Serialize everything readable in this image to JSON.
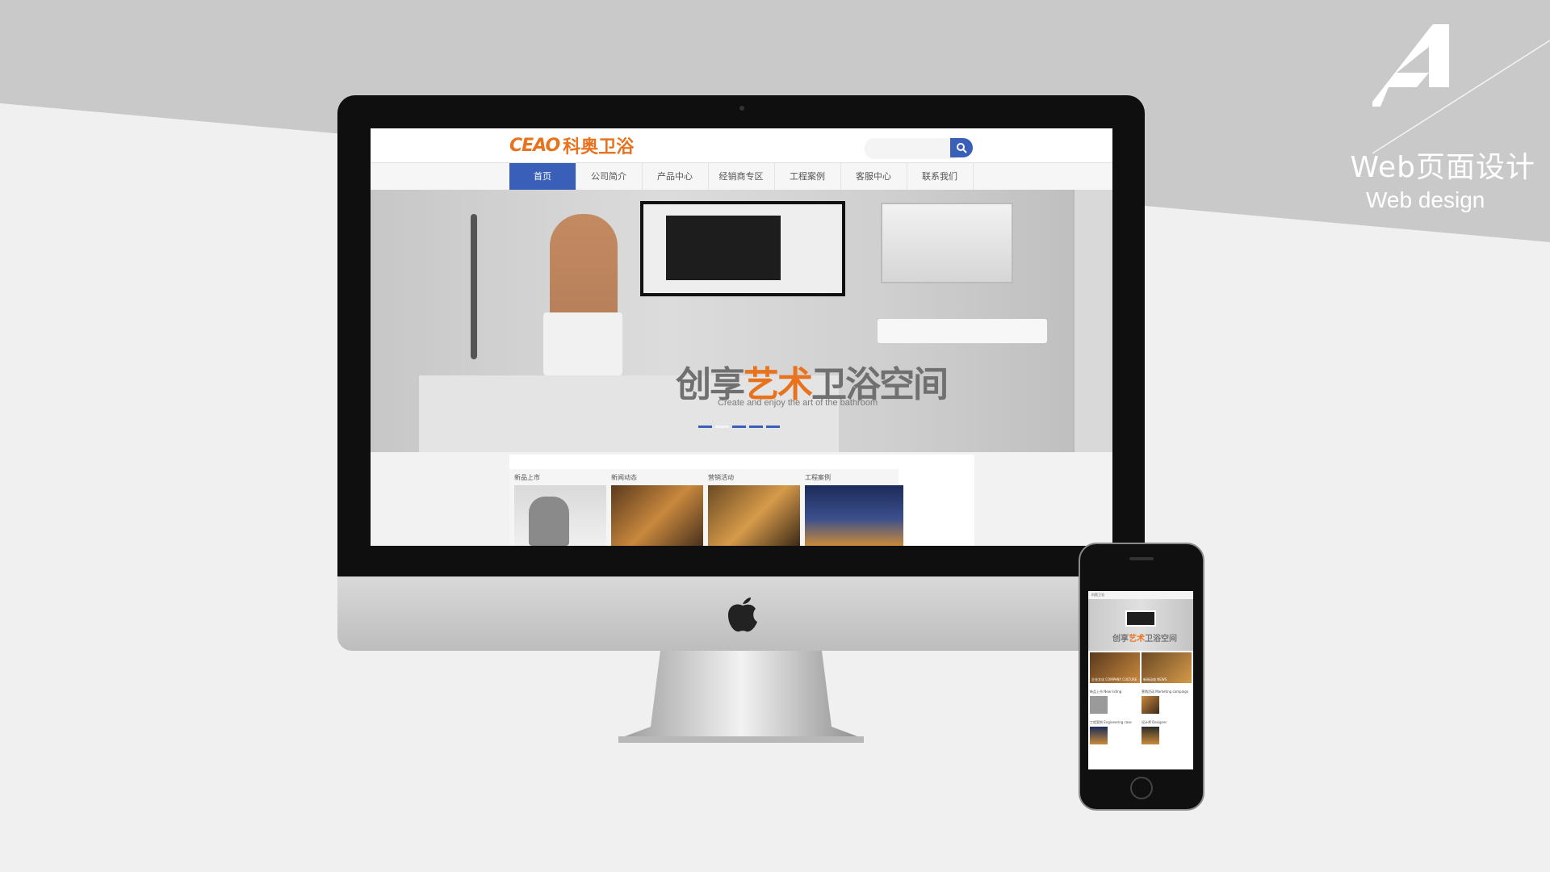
{
  "caption": {
    "title_cn": "Web页面设计",
    "title_en": "Web design"
  },
  "site": {
    "logo_en": "CEAO",
    "logo_cn": "科奥卫浴",
    "search_placeholder": "",
    "nav": [
      "首页",
      "公司简介",
      "产品中心",
      "经销商专区",
      "工程案例",
      "客服中心",
      "联系我们"
    ],
    "nav_active_index": 0,
    "hero": {
      "slogan_pre": "创享",
      "slogan_highlight": "艺术",
      "slogan_post": "卫浴空间",
      "slogan_en": "Create and enjoy the art of the bathroom",
      "slide_count": 5,
      "active_slide": 1
    },
    "cards": [
      {
        "label": "新品上市"
      },
      {
        "label": "新闻动态"
      },
      {
        "label": "营销活动"
      },
      {
        "label": "工程案例"
      }
    ]
  },
  "mobile": {
    "header": "科奥卫浴",
    "slogan_pre": "创享",
    "slogan_highlight": "艺术",
    "slogan_post": "卫浴空间",
    "thumb_captions": [
      "企业文化 COMPANY CULTURE",
      "新闻动态 NEWS"
    ],
    "sections": [
      {
        "title": "新品上市 New listing"
      },
      {
        "title": "营销活动 Marketing campaign"
      },
      {
        "title": "工程案例 Engineering case"
      },
      {
        "title": "设计师 Designer"
      }
    ]
  },
  "colors": {
    "accent_blue": "#3a5fb8",
    "logo_orange": "#e8731f"
  }
}
